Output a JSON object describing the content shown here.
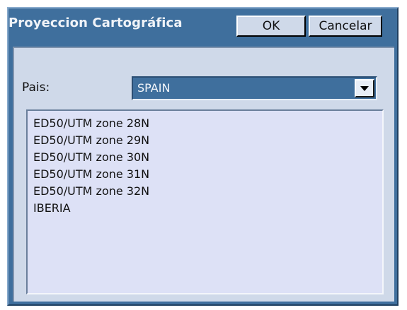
{
  "dialog": {
    "title": "Proyeccion Cartográfica",
    "ok_label": "OK",
    "cancel_label": "Cancelar"
  },
  "country": {
    "label": "Pais:",
    "selected": "SPAIN"
  },
  "projections": {
    "items": [
      "ED50/UTM zone 28N",
      "ED50/UTM zone 29N",
      "ED50/UTM zone 30N",
      "ED50/UTM zone 31N",
      "ED50/UTM zone 32N",
      "IBERIA"
    ]
  },
  "colors": {
    "frame": "#3f6f9d",
    "panel": "#cfd9e9",
    "list_background": "#dde1f6"
  }
}
